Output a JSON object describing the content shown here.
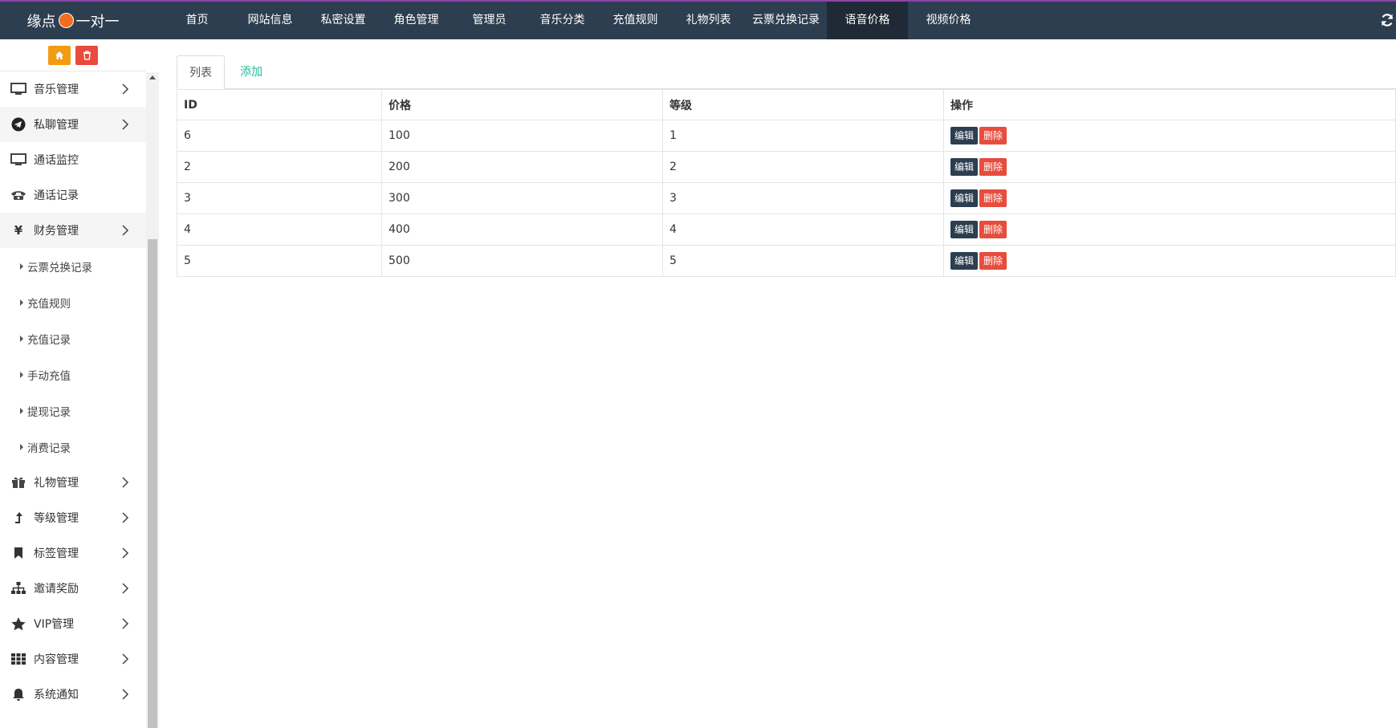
{
  "header": {
    "logo_prefix": "缘点",
    "logo_suffix": "一对一",
    "nav": [
      {
        "label": "首页"
      },
      {
        "label": "网站信息"
      },
      {
        "label": "私密设置"
      },
      {
        "label": "角色管理"
      },
      {
        "label": "管理员"
      },
      {
        "label": "音乐分类"
      },
      {
        "label": "充值规则"
      },
      {
        "label": "礼物列表"
      },
      {
        "label": "云票兑换记录"
      },
      {
        "label": "语音价格",
        "active": true
      },
      {
        "label": "视频价格"
      }
    ]
  },
  "sidebar": {
    "menu_top": [
      {
        "label": "音乐管理",
        "icon": "monitor-icon"
      },
      {
        "label": "私聊管理",
        "icon": "telegram-icon"
      },
      {
        "label": "通话监控",
        "icon": "monitor-icon"
      },
      {
        "label": "通话记录",
        "icon": "phone-icon"
      },
      {
        "label": "财务管理",
        "icon": "yen-icon"
      }
    ],
    "finance_sub": [
      {
        "label": "云票兑换记录"
      },
      {
        "label": "充值规则"
      },
      {
        "label": "充值记录"
      },
      {
        "label": "手动充值"
      },
      {
        "label": "提现记录"
      },
      {
        "label": "消费记录"
      }
    ],
    "menu_bottom": [
      {
        "label": "礼物管理",
        "icon": "gift-icon"
      },
      {
        "label": "等级管理",
        "icon": "level-up-icon"
      },
      {
        "label": "标签管理",
        "icon": "bookmark-icon"
      },
      {
        "label": "邀请奖励",
        "icon": "sitemap-icon"
      },
      {
        "label": "VIP管理",
        "icon": "star-icon"
      },
      {
        "label": "内容管理",
        "icon": "grid-icon"
      },
      {
        "label": "系统通知",
        "icon": "bell-icon"
      }
    ]
  },
  "main": {
    "tabs": {
      "list": "列表",
      "add": "添加"
    },
    "table": {
      "headers": [
        "ID",
        "价格",
        "等级",
        "操作"
      ],
      "rows": [
        {
          "id": "6",
          "price": "100",
          "level": "1"
        },
        {
          "id": "2",
          "price": "200",
          "level": "2"
        },
        {
          "id": "3",
          "price": "300",
          "level": "3"
        },
        {
          "id": "4",
          "price": "400",
          "level": "4"
        },
        {
          "id": "5",
          "price": "500",
          "level": "5"
        }
      ],
      "edit_label": "编辑",
      "delete_label": "删除"
    }
  },
  "colors": {
    "topbar": "#2d3e50",
    "active_nav": "#1f2a36",
    "accent_green": "#18bc9c",
    "danger": "#e74c3c",
    "warning": "#f39c12"
  }
}
